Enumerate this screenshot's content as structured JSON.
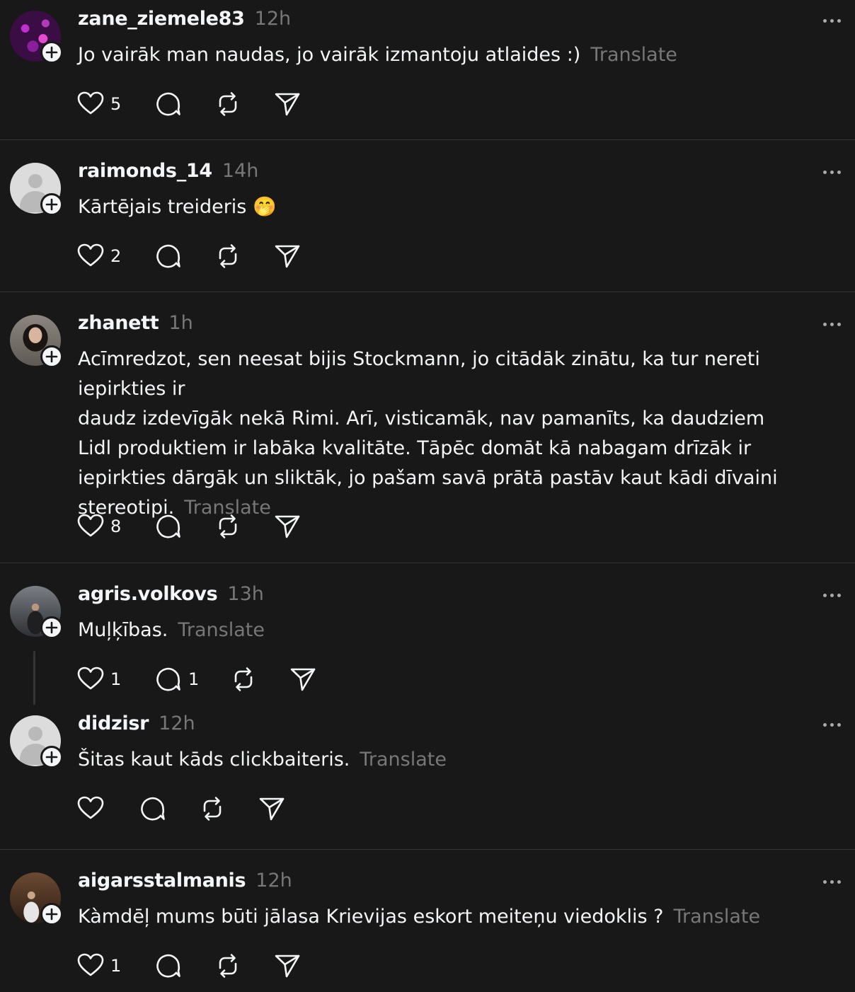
{
  "posts": [
    {
      "username": "zane_ziemele83",
      "time": "12h",
      "text": "Jo vairāk man naudas, jo vairāk izmantoju atlaides :)",
      "translate": "Translate",
      "likes": "5",
      "replies": ""
    },
    {
      "username": "raimonds_14",
      "time": "14h",
      "text": "Kārtējais treideris",
      "emoji": "🤭",
      "translate": "",
      "likes": "2",
      "replies": ""
    },
    {
      "username": "zhanett",
      "time": "1h",
      "text_lines": [
        "Acīmredzot, sen neesat bijis Stockmann, jo citādāk zinātu, ka tur nereti iepirkties ir",
        "daudz izdevīgāk nekā Rimi. Arī, visticamāk, nav pamanīts, ka daudziem",
        "Lidl produktiem ir labāka kvalitāte. Tāpēc domāt kā nabagam drīzāk ir",
        "iepirkties dārgāk un sliktāk, jo pašam savā prātā pastāv kaut kādi dīvaini",
        "stereotipi."
      ],
      "translate": "Translate",
      "likes": "8",
      "replies": ""
    },
    {
      "username": "agris.volkovs",
      "time": "13h",
      "text": "Muļķības.",
      "translate": "Translate",
      "likes": "1",
      "replies": "1"
    },
    {
      "username": "didzisr",
      "time": "12h",
      "text": "Šitas kaut kāds clickbaiteris.",
      "translate": "Translate",
      "likes": "",
      "replies": ""
    },
    {
      "username": "aigarsstalmanis",
      "time": "12h",
      "text": "Kàmdēļ mums būti jālasa Krievijas eskort meiteņu viedoklis ?",
      "translate": "Translate",
      "likes": "1",
      "replies": ""
    }
  ],
  "icons": {
    "like": "heart-icon",
    "reply": "comment-icon",
    "repost": "repost-icon",
    "share": "send-icon",
    "follow": "plus-icon",
    "more": "more-icon"
  },
  "colors": {
    "background": "#181818",
    "text": "#f3f5f7",
    "muted": "#777777",
    "divider": "#333638"
  }
}
